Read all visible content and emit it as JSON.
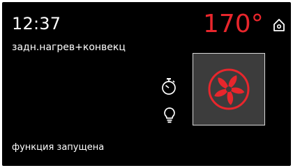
{
  "display": {
    "time": "12:37",
    "mode": "задн.нагрев+конвекц",
    "temperature": "170°",
    "status": "функция запущена"
  },
  "icons": {
    "home": "home-icon",
    "timer": "timer-icon",
    "lamp": "lamp-icon",
    "fan": "convection-fan-icon"
  },
  "colors": {
    "accent": "#e8262c",
    "background": "#000000",
    "tile": "#3c3c3c",
    "text": "#ffffff"
  }
}
